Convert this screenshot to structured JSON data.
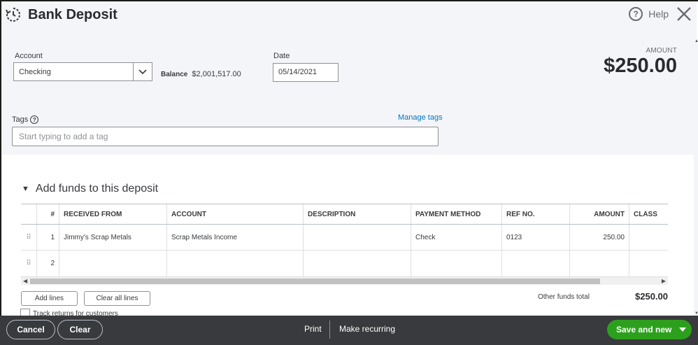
{
  "header": {
    "title": "Bank Deposit",
    "help_label": "Help"
  },
  "form": {
    "account_label": "Account",
    "account_value": "Checking",
    "balance_label": "Balance",
    "balance_value": "$2,001,517.00",
    "date_label": "Date",
    "date_value": "05/14/2021",
    "amount_label": "AMOUNT",
    "amount_value": "$250.00",
    "tags_label": "Tags",
    "manage_tags": "Manage tags",
    "tags_placeholder": "Start typing to add a tag"
  },
  "section": {
    "title": "Add funds to this deposit",
    "columns": [
      "#",
      "RECEIVED FROM",
      "ACCOUNT",
      "DESCRIPTION",
      "PAYMENT METHOD",
      "REF NO.",
      "AMOUNT",
      "CLASS"
    ],
    "rows": [
      {
        "num": "1",
        "received_from": "Jimmy's Scrap Metals",
        "account": "Scrap Metals Income",
        "description": "",
        "payment_method": "Check",
        "ref_no": "0123",
        "amount": "250.00",
        "class": ""
      },
      {
        "num": "2",
        "received_from": "",
        "account": "",
        "description": "",
        "payment_method": "",
        "ref_no": "",
        "amount": "",
        "class": ""
      }
    ],
    "add_lines": "Add lines",
    "clear_all_lines": "Clear all lines",
    "other_funds_label": "Other funds total",
    "other_funds_value": "$250.00",
    "track_returns": "Track returns for customers"
  },
  "footer": {
    "cancel": "Cancel",
    "clear": "Clear",
    "print": "Print",
    "make_recurring": "Make recurring",
    "save_and_new": "Save and new"
  },
  "colors": {
    "primary_green": "#2ca01c",
    "link_blue": "#0077c5",
    "footer_bg": "#393a3d"
  }
}
